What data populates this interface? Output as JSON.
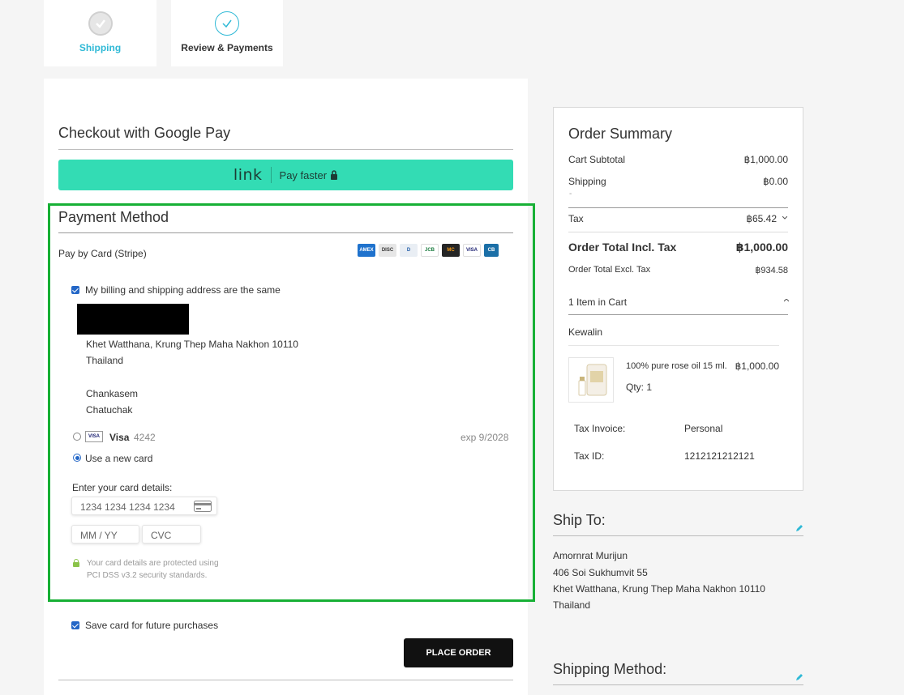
{
  "steps": {
    "shipping": "Shipping",
    "review": "Review & Payments"
  },
  "left": {
    "google_pay_title": "Checkout with Google Pay",
    "link_logo": "link",
    "link_text": "Pay faster",
    "payment_method_title": "Payment Method",
    "pay_by_card": "Pay by Card (Stripe)",
    "card_brands": [
      "AMEX",
      "DISC",
      "D",
      "JCB",
      "MC",
      "VISA",
      "CB"
    ],
    "billing_same": "My billing and shipping address are the same",
    "address": {
      "line1": "Khet Watthana, Krung Thep Maha Nakhon 10110",
      "line2": "Thailand",
      "line3": "Chankasem",
      "line4": "Chatuchak"
    },
    "saved_card_brand": "Visa",
    "saved_card_last4": "4242",
    "saved_card_exp": "exp 9/2028",
    "saved_card_badge": "VISA",
    "use_new_card": "Use a new card",
    "enter_details": "Enter your card details:",
    "card_number_placeholder": "1234 1234 1234 1234",
    "expiry_placeholder": "MM / YY",
    "cvc_placeholder": "CVC",
    "security_line1": "Your card details are protected using",
    "security_line2": "PCI DSS v3.2 security standards.",
    "save_card": "Save card for future purchases",
    "place_order": "PLACE ORDER"
  },
  "summary": {
    "title": "Order Summary",
    "cart_subtotal_label": "Cart Subtotal",
    "cart_subtotal": "฿1,000.00",
    "shipping_label": "Shipping",
    "shipping_value": "฿0.00",
    "shipping_dash": "-",
    "tax_label": "Tax",
    "tax_value": "฿65.42",
    "total_incl_label": "Order Total Incl. Tax",
    "total_incl": "฿1,000.00",
    "total_excl_label": "Order Total Excl. Tax",
    "total_excl": "฿934.58",
    "items_in_cart": "1 Item in Cart",
    "seller": "Kewalin",
    "product_name": "100% pure rose oil 15 ml.",
    "product_price": "฿1,000.00",
    "qty": "Qty: 1",
    "tax_invoice_label": "Tax Invoice:",
    "tax_invoice_value": "Personal",
    "tax_id_label": "Tax ID:",
    "tax_id_value": "1212121212121"
  },
  "ship_to": {
    "title": "Ship To:",
    "name": "Amornrat Murijun",
    "street": "406 Soi Sukhumvit 55",
    "city": "Khet Watthana, Krung Thep Maha Nakhon 10110",
    "country": "Thailand"
  },
  "shipping_method": {
    "title": "Shipping Method:"
  },
  "colors": {
    "accent": "#2fb9d6",
    "link_green": "#33dcb4",
    "highlight_border": "#17b035",
    "checkbox_blue": "#2467c7"
  }
}
